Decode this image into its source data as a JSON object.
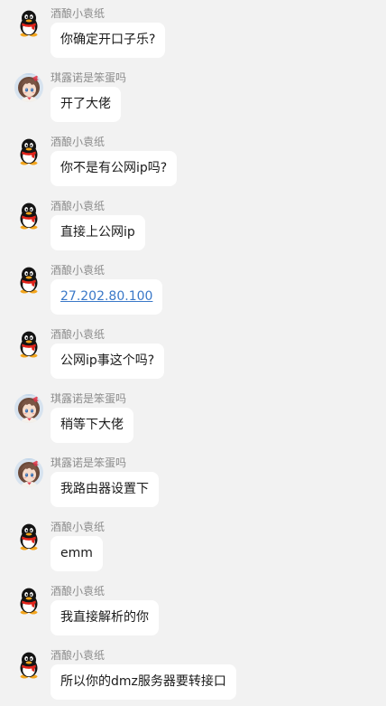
{
  "users": {
    "a": {
      "name": "酒酿小袁纸",
      "avatar_icon": "qq-penguin-icon"
    },
    "b": {
      "name": "琪露诺是笨蛋吗",
      "avatar_icon": "anime-character-avatar"
    }
  },
  "messages": [
    {
      "sender": "酒酿小袁纸",
      "text": "你确定开口子乐?"
    },
    {
      "sender": "琪露诺是笨蛋吗",
      "text": "开了大佬"
    },
    {
      "sender": "酒酿小袁纸",
      "text": "你不是有公网ip吗?"
    },
    {
      "sender": "酒酿小袁纸",
      "text": "直接上公网ip"
    },
    {
      "sender": "酒酿小袁纸",
      "text": "27.202.80.100",
      "is_link": true
    },
    {
      "sender": "酒酿小袁纸",
      "text": "公网ip事这个吗?"
    },
    {
      "sender": "琪露诺是笨蛋吗",
      "text": "稍等下大佬"
    },
    {
      "sender": "琪露诺是笨蛋吗",
      "text": "我路由器设置下"
    },
    {
      "sender": "酒酿小袁纸",
      "text": "emm"
    },
    {
      "sender": "酒酿小袁纸",
      "text": "我直接解析的你"
    },
    {
      "sender": "酒酿小袁纸",
      "text": "所以你的dmz服务器要转接口"
    }
  ],
  "colors": {
    "background": "#f2f2f2",
    "bubble": "#ffffff",
    "sender_name": "#8c8c8c",
    "link": "#3a78c8"
  }
}
